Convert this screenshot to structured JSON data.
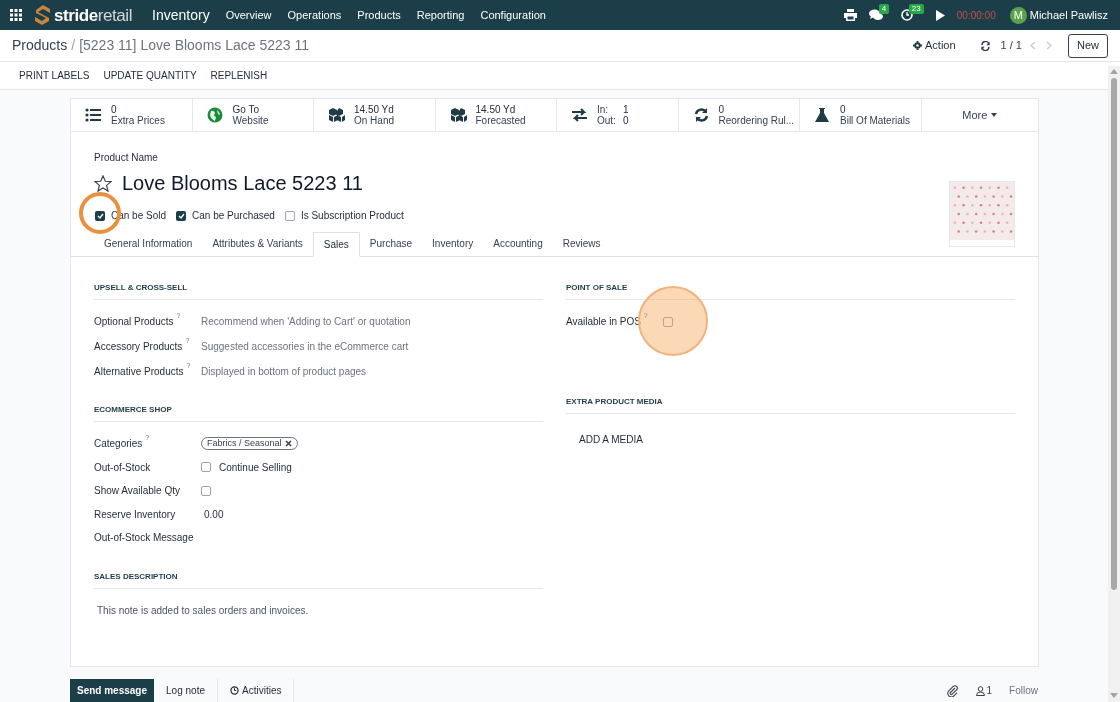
{
  "navbar": {
    "brand": {
      "primary": "stride",
      "secondary": "retail"
    },
    "app": "Inventory",
    "menu": [
      "Overview",
      "Operations",
      "Products",
      "Reporting",
      "Configuration"
    ],
    "messages_badge": "4",
    "activities_badge": "23",
    "timer": "00:00:00",
    "user": {
      "initial": "M",
      "name": "Michael Pawlisz"
    }
  },
  "breadcrumb": {
    "parent": "Products",
    "separator": "/",
    "current": "[5223 11] Love Blooms Lace 5223 11"
  },
  "control": {
    "action": "Action",
    "pager": "1 / 1",
    "new": "New"
  },
  "header_buttons": [
    "PRINT LABELS",
    "UPDATE QUANTITY",
    "REPLENISH"
  ],
  "smart_buttons": [
    {
      "kind": "stat",
      "value": "0",
      "label": "Extra Prices"
    },
    {
      "kind": "stat",
      "value": "Go To",
      "label": "Website"
    },
    {
      "kind": "stat",
      "value": "14.50 Yd",
      "label": "On Hand"
    },
    {
      "kind": "stat",
      "value": "14.50 Yd",
      "label": "Forecasted"
    },
    {
      "kind": "inout",
      "in_label": "In:",
      "in_value": "1",
      "out_label": "Out:",
      "out_value": "0"
    },
    {
      "kind": "stat",
      "value": "0",
      "label": "Reordering Rul..."
    },
    {
      "kind": "stat",
      "value": "0",
      "label": "Bill Of Materials"
    },
    {
      "kind": "more",
      "label": "More"
    }
  ],
  "product": {
    "name_label": "Product Name",
    "name": "Love Blooms Lace 5223 11",
    "favorite": false
  },
  "options": [
    {
      "label": "Can be Sold",
      "checked": true,
      "highlighted": true
    },
    {
      "label": "Can be Purchased",
      "checked": true,
      "highlighted": false
    },
    {
      "label": "Is Subscription Product",
      "checked": false,
      "highlighted": false
    }
  ],
  "tabs": [
    {
      "label": "General Information",
      "selected": false
    },
    {
      "label": "Attributes & Variants",
      "selected": false
    },
    {
      "label": "Sales",
      "selected": true
    },
    {
      "label": "Purchase",
      "selected": false
    },
    {
      "label": "Inventory",
      "selected": false
    },
    {
      "label": "Accounting",
      "selected": false
    },
    {
      "label": "Reviews",
      "selected": false
    }
  ],
  "upsell": {
    "title": "UPSELL & CROSS-SELL",
    "fields": [
      {
        "label": "Optional Products",
        "help": "?",
        "placeholder": "Recommend when 'Adding to Cart' or quotation"
      },
      {
        "label": "Accessory Products",
        "help": "?",
        "placeholder": "Suggested accessories in the eCommerce cart"
      },
      {
        "label": "Alternative Products",
        "help": "?",
        "placeholder": "Displayed in bottom of product pages"
      }
    ]
  },
  "ecommerce": {
    "title": "ECOMMERCE SHOP",
    "fields": [
      {
        "kind": "tag",
        "label": "Categories",
        "help": "?",
        "tag": "Fabrics / Seasonal"
      },
      {
        "kind": "checkbox",
        "label": "Out-of-Stock",
        "checked": false,
        "text": "Continue Selling"
      },
      {
        "kind": "checkbox",
        "label": "Show Available Qty",
        "checked": false
      },
      {
        "kind": "value",
        "label": "Reserve Inventory",
        "value": "0.00"
      },
      {
        "kind": "empty",
        "label": "Out-of-Stock Message"
      }
    ]
  },
  "point_of_sale": {
    "title": "POINT OF SALE",
    "field": {
      "label": "Available in POS",
      "help": "?",
      "checked": false,
      "highlighted": true
    }
  },
  "media": {
    "title": "EXTRA PRODUCT MEDIA",
    "button": "ADD A MEDIA"
  },
  "sales_description": {
    "title": "SALES DESCRIPTION",
    "placeholder": "This note is added to sales orders and invoices."
  },
  "chatter": {
    "buttons": [
      {
        "label": "Send message",
        "selected": true
      },
      {
        "label": "Log note",
        "selected": false
      },
      {
        "label": "Activities",
        "selected": false
      }
    ],
    "followers": "1",
    "follow": "Follow"
  }
}
